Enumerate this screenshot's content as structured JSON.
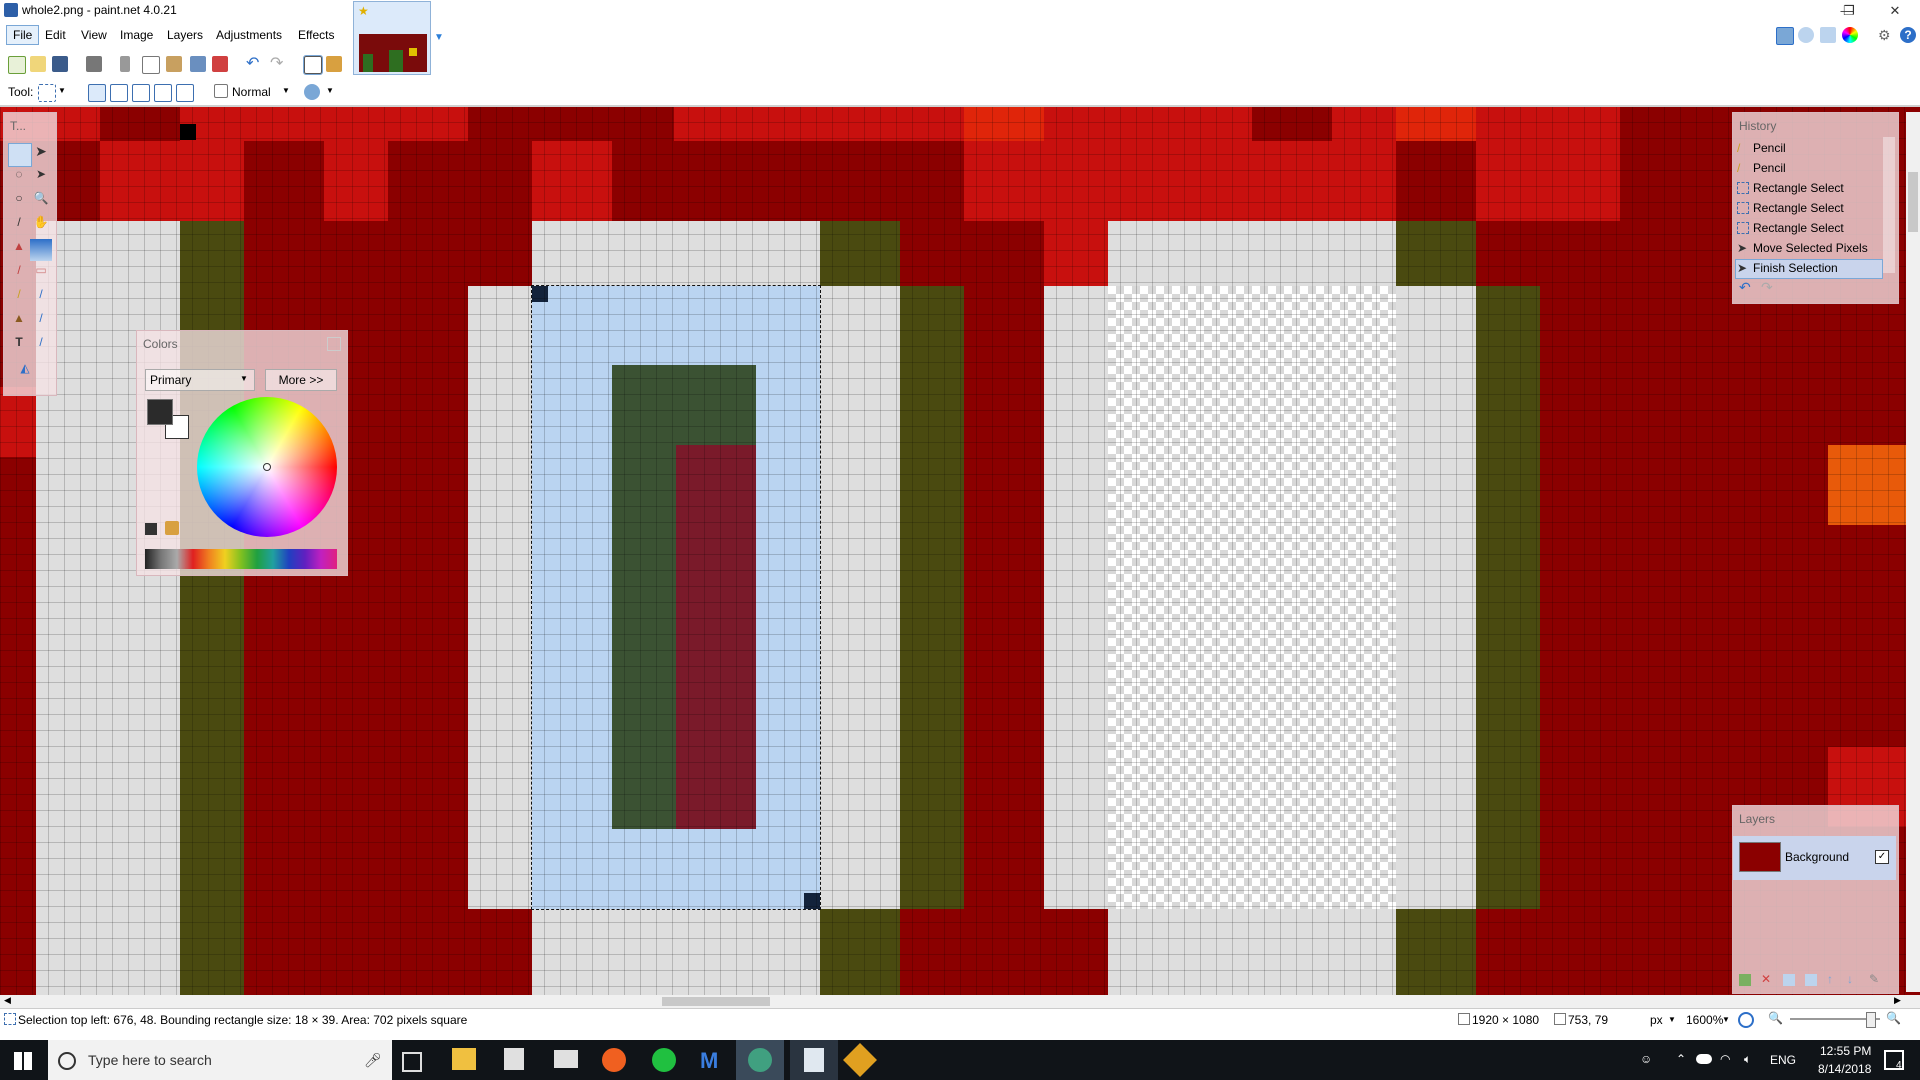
{
  "window": {
    "title": "whole2.png - paint.net 4.0.21",
    "min": "—",
    "max": "❐",
    "close": "✕"
  },
  "menu": [
    "File",
    "Edit",
    "View",
    "Image",
    "Layers",
    "Adjustments",
    "Effects"
  ],
  "toolbar": {
    "tool_label": "Tool:",
    "blend_mode": "Normal"
  },
  "colors_panel": {
    "title": "Colors",
    "mode": "Primary",
    "more_button": "More >>",
    "primary_color": "#2b2b2b",
    "secondary_color": "#ffffff"
  },
  "history_panel": {
    "title": "History",
    "items": [
      "Pencil",
      "Pencil",
      "Rectangle Select",
      "Rectangle Select",
      "Rectangle Select",
      "Move Selected Pixels",
      "Finish Selection"
    ]
  },
  "layers_panel": {
    "title": "Layers",
    "layers": [
      {
        "name": "Background",
        "visible": true
      }
    ]
  },
  "tools_panel": {
    "title": "T..."
  },
  "status": {
    "selection_info": "Selection top left: 676, 48. Bounding rectangle size: 18 × 39. Area: 702 pixels square",
    "image_size": "1920 × 1080",
    "cursor_pos": "753, 79",
    "units": "px",
    "zoom": "1600%"
  },
  "taskbar": {
    "search_placeholder": "Type here to search",
    "language": "ENG",
    "time": "12:55 PM",
    "date": "8/14/2018",
    "notification_count": "4"
  },
  "canvas_colors": {
    "dark_red": "#8b0000",
    "red": "#c8100e",
    "olive": "#4a4a10",
    "light_gray": "#dedede",
    "dark_green": "#3b5233",
    "maroon": "#7a1a2a",
    "orange": "#e85a0a"
  }
}
